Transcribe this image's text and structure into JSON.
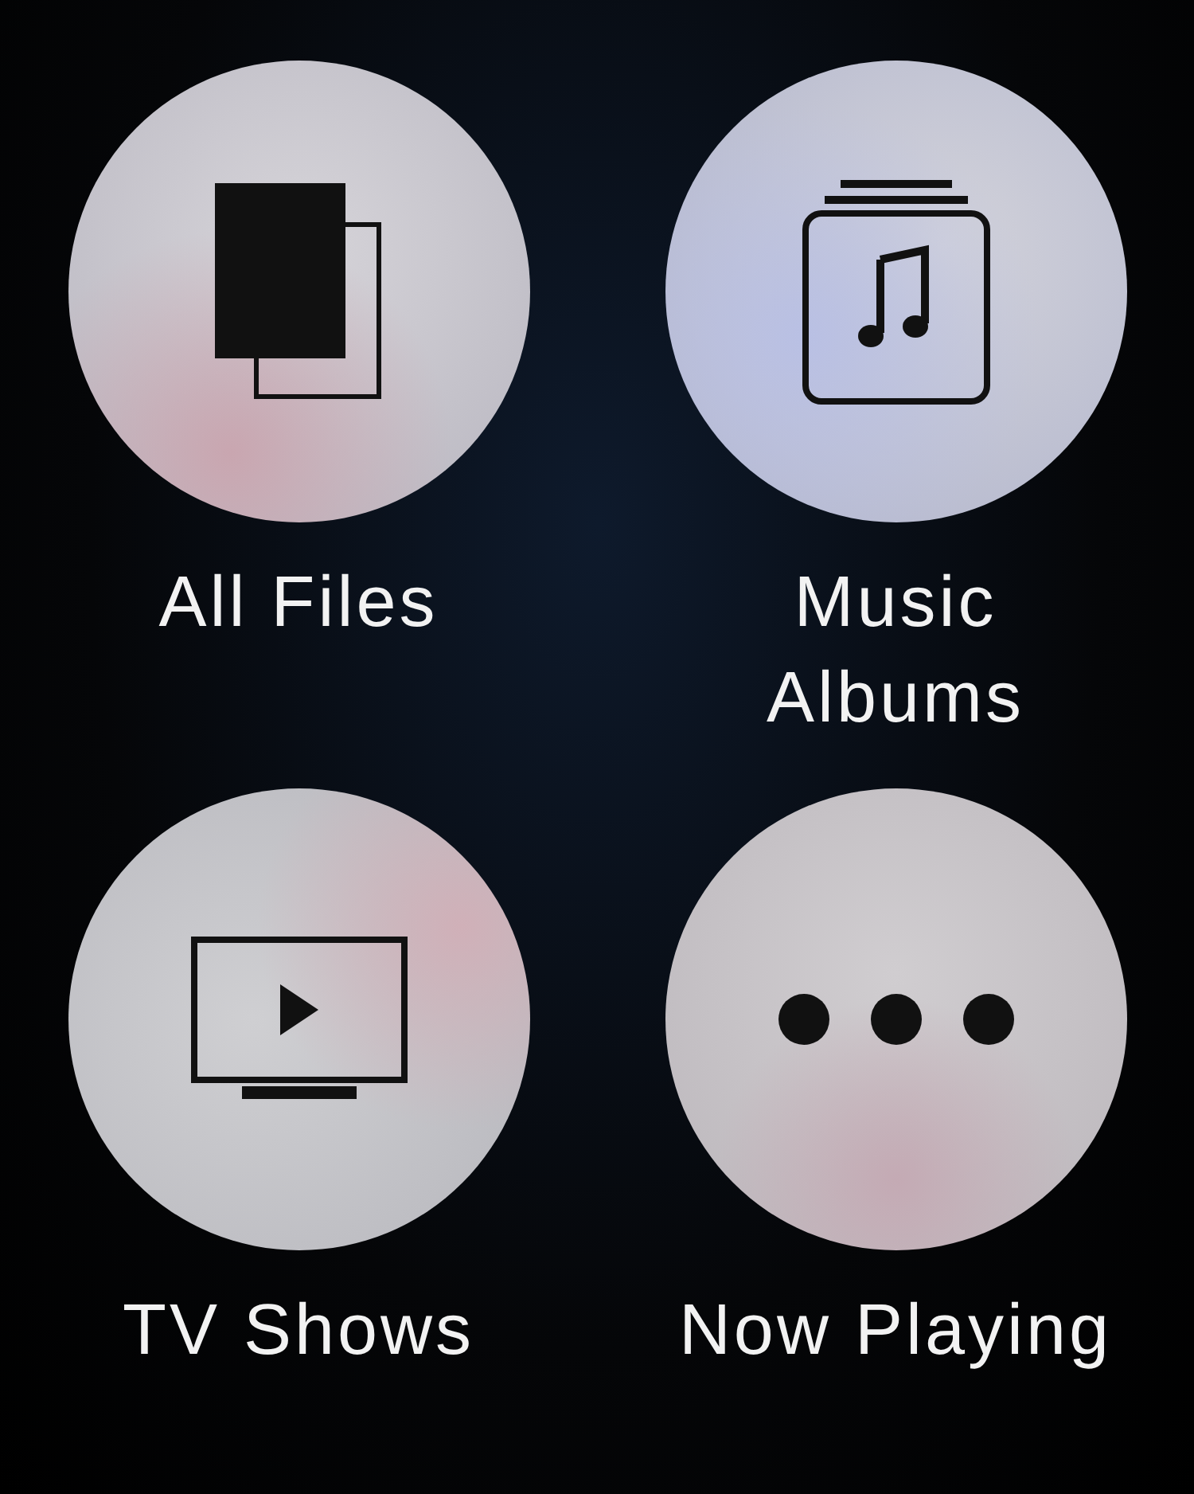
{
  "items": [
    {
      "kind": "files",
      "label": "All Files"
    },
    {
      "kind": "albums",
      "label": "Music Albums"
    },
    {
      "kind": "tv",
      "label": "TV Shows"
    },
    {
      "kind": "more",
      "label": "Now Playing"
    }
  ]
}
